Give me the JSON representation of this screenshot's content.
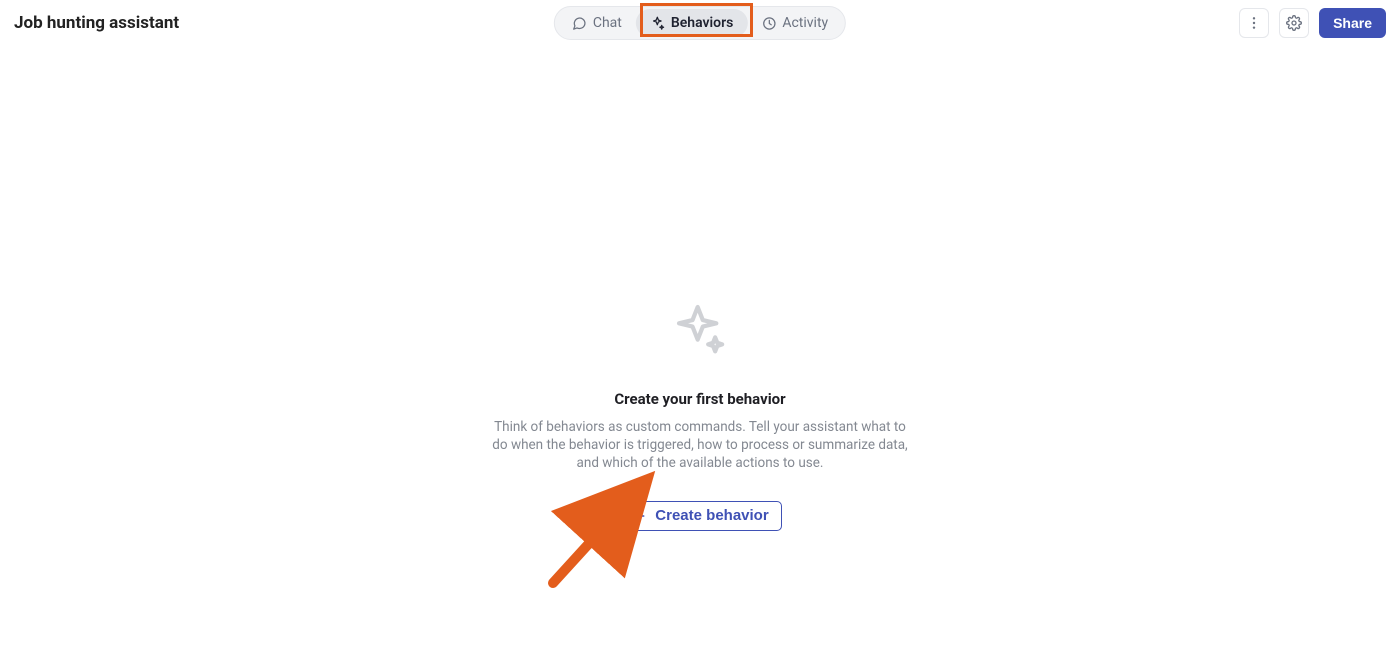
{
  "header": {
    "title": "Job hunting assistant",
    "tabs": [
      {
        "label": "Chat"
      },
      {
        "label": "Behaviors"
      },
      {
        "label": "Activity"
      }
    ],
    "active_tab_index": 1,
    "share_label": "Share"
  },
  "empty_state": {
    "title": "Create your first behavior",
    "description": "Think of behaviors as custom commands. Tell your assistant what to do when the behavior is triggered, how to process or summarize data, and which of the available actions to use.",
    "create_label": "Create behavior"
  },
  "colors": {
    "accent": "#3f51b5",
    "annotation": "#e35d1c",
    "muted_text": "#838891",
    "bg": "#ffffff"
  },
  "annotations": {
    "behaviors_tab_highlighted": true,
    "arrow_points_to": "create-behavior-button"
  }
}
